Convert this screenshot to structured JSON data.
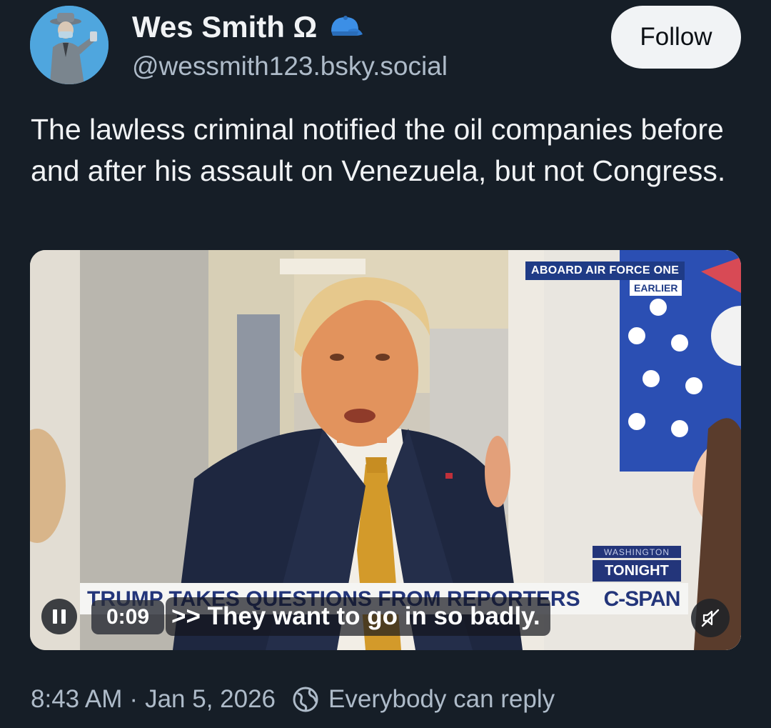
{
  "author": {
    "display_name": "Wes Smith Ω",
    "handle": "@wessmith123.bsky.social",
    "avatar_icon": "detective-avatar",
    "badge_icon": "blue-cap-icon"
  },
  "follow_label": "Follow",
  "post_text": "The lawless criminal notified the oil companies before and after his assault on Venezuela, but not Congress.",
  "video": {
    "overlay_aboard": "ABOARD AIR FORCE ONE",
    "overlay_earlier": "EARLIER",
    "overlay_washington": "WASHINGTON",
    "overlay_tonight": "TONIGHT",
    "lower_third": "TRUMP TAKES QUESTIONS FROM REPORTERS",
    "network": "C-SPAN",
    "time": "0:09",
    "caption": ">> They want to go in so badly.",
    "play_state_icon": "pause-icon",
    "mute_icon": "muted-speaker-icon"
  },
  "footer": {
    "time": "8:43 AM",
    "separator": "·",
    "date": "Jan 5, 2026",
    "reply_setting": "Everybody can reply",
    "reply_icon": "globe-icon"
  },
  "colors": {
    "background": "#161e27",
    "text_primary": "#f1f3f5",
    "text_secondary": "#aebbc9",
    "follow_bg": "#f1f3f5",
    "avatar_bg": "#4fa6de",
    "badge_blue": "#3c8fe6",
    "cspan_blue": "#23357a"
  }
}
